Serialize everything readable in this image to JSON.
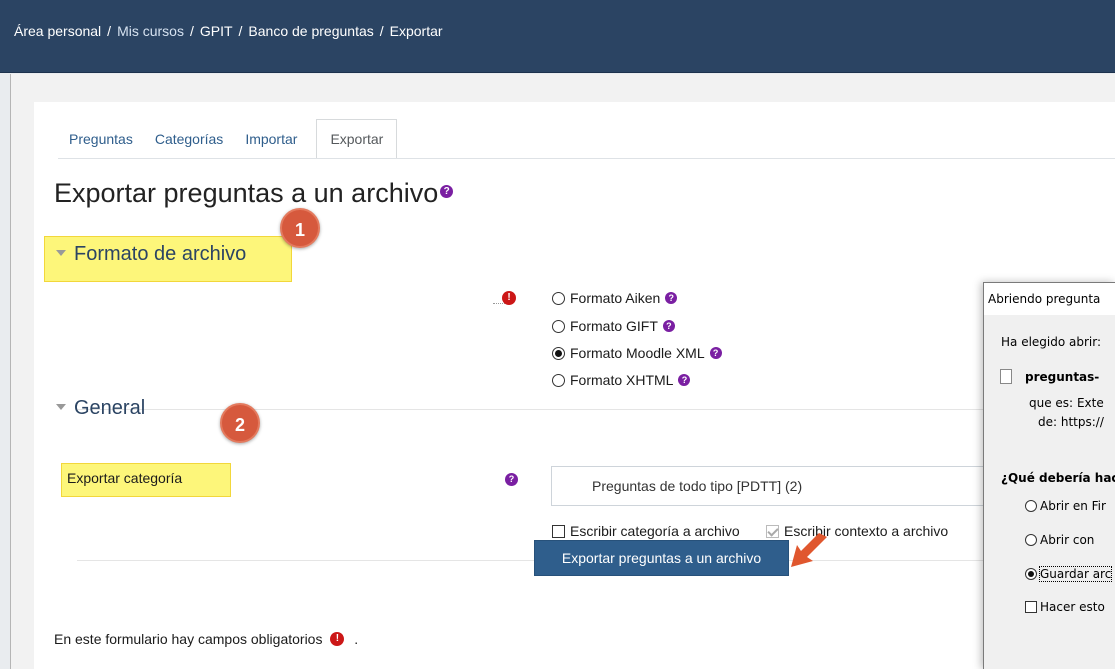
{
  "breadcrumb": {
    "items": [
      {
        "label": "Área personal",
        "link": false
      },
      {
        "label": "Mis cursos",
        "link": true
      },
      {
        "label": "GPIT",
        "link": false
      },
      {
        "label": "Banco de preguntas",
        "link": false
      },
      {
        "label": "Exportar",
        "link": false
      }
    ],
    "separator": "/"
  },
  "tabs": [
    {
      "label": "Preguntas",
      "active": false
    },
    {
      "label": "Categorías",
      "active": false
    },
    {
      "label": "Importar",
      "active": false
    },
    {
      "label": "Exportar",
      "active": true
    }
  ],
  "page_title": "Exportar preguntas a un archivo",
  "sections": {
    "format": {
      "title": "Formato de archivo",
      "options": [
        {
          "label": "Formato Aiken",
          "selected": false
        },
        {
          "label": "Formato GIFT",
          "selected": false
        },
        {
          "label": "Formato Moodle XML",
          "selected": true
        },
        {
          "label": "Formato XHTML",
          "selected": false
        }
      ]
    },
    "general": {
      "title": "General",
      "category_label": "Exportar categoría",
      "category_value": "Preguntas de todo tipo [PDTT] (2)",
      "write_category_label": "Escribir categoría a archivo",
      "write_category_checked": false,
      "write_context_label": "Escribir contexto a archivo",
      "write_context_checked": true
    }
  },
  "submit_label": "Exportar preguntas a un archivo",
  "footer_note": "En este formulario hay campos obligatorios",
  "footer_suffix": ".",
  "annotations": {
    "badge1": "1",
    "badge2": "2"
  },
  "icons": {
    "help": "?",
    "required": "!"
  },
  "dialog": {
    "title": "Abriendo pregunta",
    "chosen_label": "Ha elegido abrir:",
    "filename": "preguntas-",
    "type_label": "que es:",
    "type_value": "Exte",
    "from_label": "de:",
    "from_value": "https://",
    "question": "¿Qué debería hac",
    "options": [
      {
        "label": "Abrir en Fir",
        "selected": false
      },
      {
        "label": "Abrir con",
        "selected": false
      },
      {
        "label": "Guardar arc",
        "selected": true
      }
    ],
    "remember_label": "Hacer esto"
  },
  "colors": {
    "topbar": "#2b4463",
    "link": "#2f5e8c",
    "button": "#2f5e8c",
    "highlight": "#fdf67a",
    "badge": "#d6593d",
    "help_icon": "#7a1fa2",
    "required_icon": "#cc1717"
  }
}
